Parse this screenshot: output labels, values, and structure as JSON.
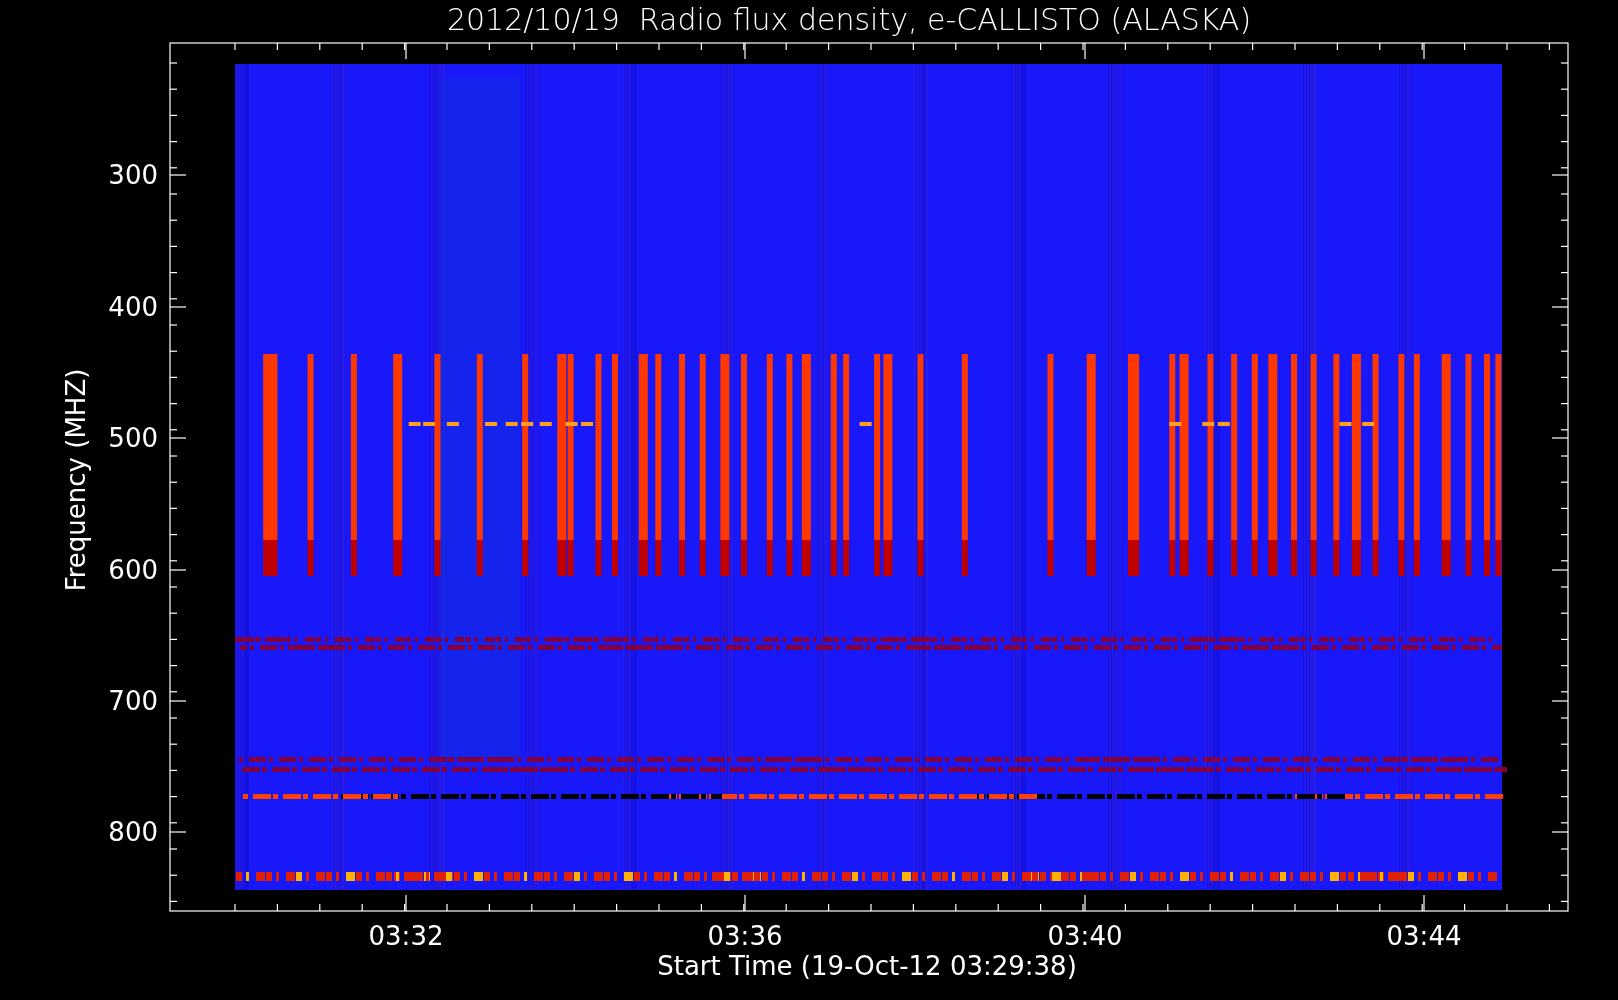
{
  "plot": {
    "title": "2012/10/19  Radio flux density, e-CALLISTO (ALASKA)",
    "ylabel": "Frequency (MHZ)",
    "xlabel": "Start Time (19-Oct-12 03:29:38)",
    "yticks": [
      "300",
      "400",
      "500",
      "600",
      "700",
      "800"
    ],
    "xticks": [
      "03:32",
      "03:36",
      "03:40",
      "03:44"
    ]
  }
}
